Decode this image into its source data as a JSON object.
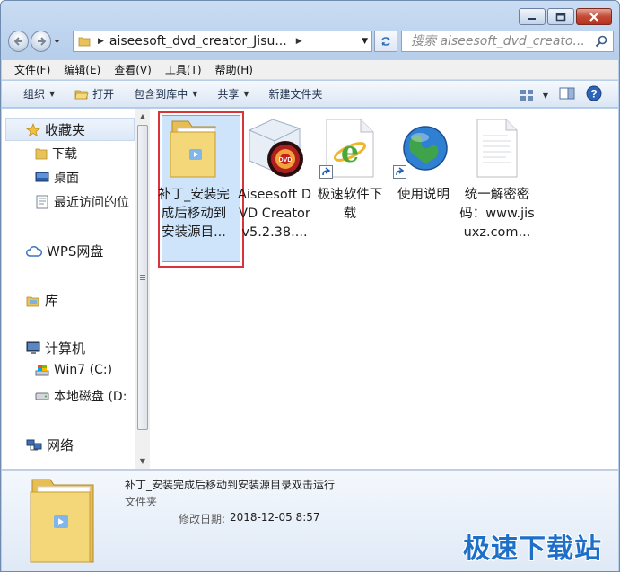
{
  "address": {
    "path": "aiseesoft_dvd_creator_Jisu...",
    "search_placeholder": "搜索 aiseesoft_dvd_creato..."
  },
  "menu": [
    "文件(F)",
    "编辑(E)",
    "查看(V)",
    "工具(T)",
    "帮助(H)"
  ],
  "commands": {
    "organize": "组织",
    "open": "打开",
    "include_in_library": "包含到库中",
    "share": "共享",
    "new_folder": "新建文件夹"
  },
  "nav": {
    "favorites": "收藏夹",
    "downloads": "下载",
    "desktop": "桌面",
    "recent": "最近访问的位",
    "wps": "WPS网盘",
    "libraries": "库",
    "computer": "计算机",
    "drive_c": "Win7 (C:)",
    "drive_d": "本地磁盘 (D:",
    "network": "网络"
  },
  "files": [
    {
      "name": "补丁_安装完成后移动到安装源目...",
      "kind": "folder",
      "selected": true
    },
    {
      "name": "Aiseesoft DVD Creator v5.2.38....",
      "kind": "dvd-app"
    },
    {
      "name": "极速软件下载",
      "kind": "ie-shortcut"
    },
    {
      "name": "使用说明",
      "kind": "globe-shortcut"
    },
    {
      "name": "统一解密密码：www.jisuxz.com...",
      "kind": "text-file"
    }
  ],
  "details": {
    "title": "补丁_安装完成后移动到安装源目录双击运行",
    "type": "文件夹",
    "date_label": "修改日期:",
    "date": "2018-12-05 8:57"
  },
  "watermark": "极速下载站",
  "colors": {
    "selection_fill": "#cde4fb",
    "highlight_border": "#d9343b",
    "watermark": "#1d6fc8"
  }
}
